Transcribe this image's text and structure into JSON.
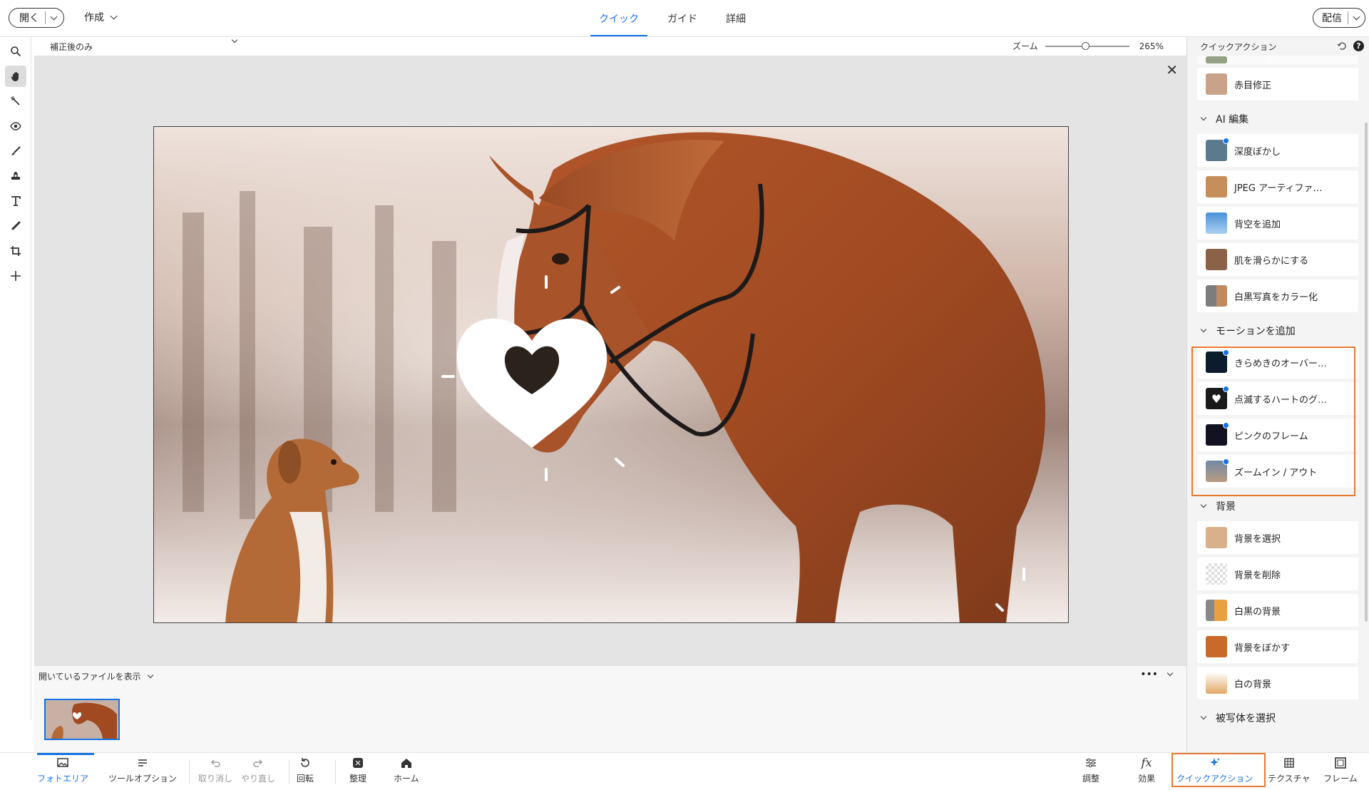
{
  "topbar": {
    "open_label": "開く",
    "create_label": "作成",
    "tabs": [
      {
        "label": "クイック",
        "active": true
      },
      {
        "label": "ガイド",
        "active": false
      },
      {
        "label": "詳細",
        "active": false
      }
    ],
    "share_label": "配信"
  },
  "options": {
    "view_select": "補正後のみ",
    "zoom_label": "ズーム",
    "zoom_value": "265%",
    "zoom_fraction": 0.48
  },
  "panel": {
    "title": "クイックアクション",
    "help": "?",
    "sections": [
      {
        "label": null,
        "items": [
          {
            "label": "赤目修正",
            "icon": "face-photo-icon",
            "color": "#c9a28a",
            "badge": false
          }
        ]
      },
      {
        "label": "AI 編集",
        "items": [
          {
            "label": "深度ぼかし",
            "icon": "depth-blur-icon",
            "color": "#5b7b8c",
            "badge": true
          },
          {
            "label": "JPEG アーティファ…",
            "icon": "portrait-icon",
            "color": "#c68e5a",
            "badge": false
          },
          {
            "label": "背空を追加",
            "icon": "sky-icon",
            "color": "#4a90d9",
            "badge": false
          },
          {
            "label": "肌を滑らかにする",
            "icon": "skin-icon",
            "color": "#8a6248",
            "badge": false
          },
          {
            "label": "白黒写真をカラー化",
            "icon": "colorize-icon",
            "color": "#7d7d7d",
            "badge": false
          }
        ]
      },
      {
        "label": "モーションを追加",
        "items": [
          {
            "label": "きらめきのオーバー…",
            "icon": "sparkle-overlay-icon",
            "color": "#0c1c2c",
            "badge": true
          },
          {
            "label": "点滅するハートのグ…",
            "icon": "heart-icon",
            "color": "#1a1a1a",
            "badge": true
          },
          {
            "label": "ピンクのフレーム",
            "icon": "frame-icon",
            "color": "#121222",
            "badge": true
          },
          {
            "label": "ズームイン / アウト",
            "icon": "zoom-photo-icon",
            "color": "#6f8aa6",
            "badge": true
          }
        ]
      },
      {
        "label": "背景",
        "items": [
          {
            "label": "背景を選択",
            "icon": "select-bg-icon",
            "color": "#d8b08a",
            "badge": false
          },
          {
            "label": "背景を削除",
            "icon": "remove-bg-icon",
            "color": "#e0c0a0",
            "badge": false
          },
          {
            "label": "白黒の背景",
            "icon": "bw-bg-icon",
            "color": "#e8a040",
            "badge": false
          },
          {
            "label": "背景をぼかす",
            "icon": "blur-bg-icon",
            "color": "#c86a2a",
            "badge": false
          },
          {
            "label": "白の背景",
            "icon": "white-bg-icon",
            "color": "#e2a868",
            "badge": false
          }
        ]
      },
      {
        "label": "被写体を選択",
        "items": []
      }
    ]
  },
  "photobin": {
    "label": "開いているファイルを表示",
    "more": "•••"
  },
  "bottombar": {
    "photo_area": "フォトエリア",
    "tool_options": "ツールオプション",
    "undo": "取り消し",
    "redo": "やり直し",
    "rotate": "回転",
    "organize": "整理",
    "home": "ホーム",
    "adjust": "調整",
    "effects": "効果",
    "quick_actions": "クイックアクション",
    "textures": "テクスチャ",
    "frames": "フレーム"
  },
  "colors": {
    "accent": "#1473e6",
    "highlight": "#e8782e"
  }
}
